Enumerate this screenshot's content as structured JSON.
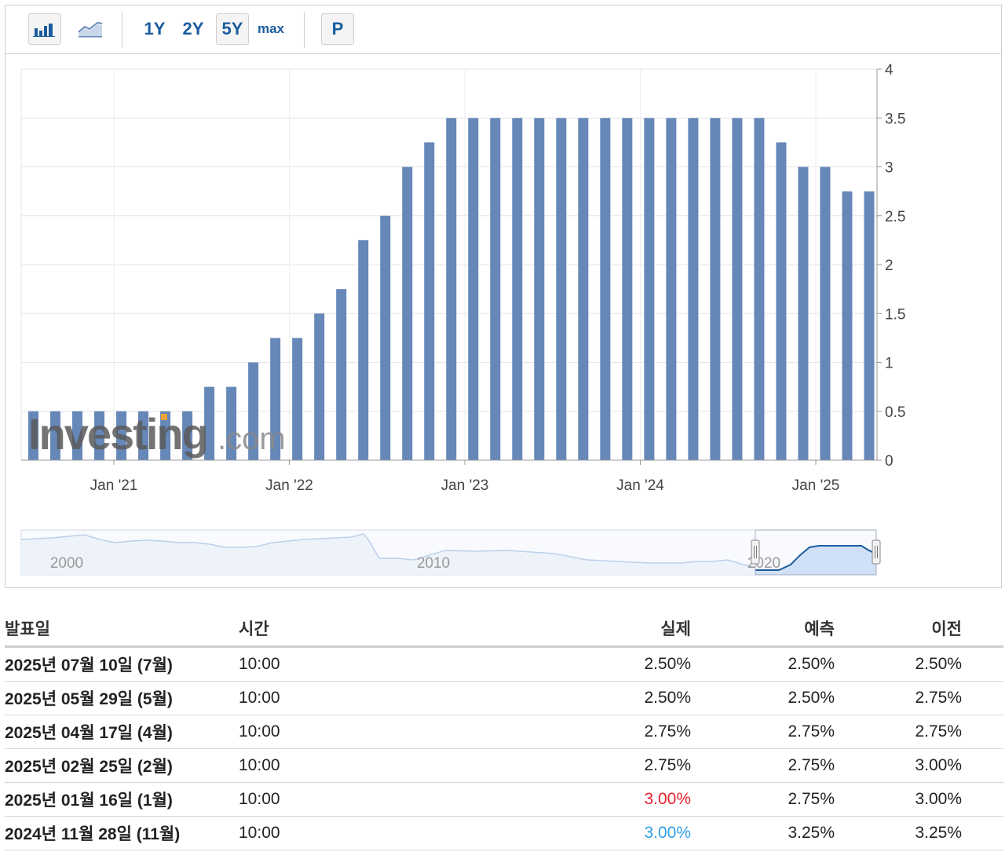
{
  "toolbar": {
    "bar_icon": "bar-chart-icon",
    "line_icon": "line-chart-icon",
    "ranges": [
      "1Y",
      "2Y",
      "5Y",
      "max"
    ],
    "selected_range": "5Y",
    "print_label": "P"
  },
  "watermark": "Investing.com",
  "colors": {
    "bar": "#6688b8",
    "accent": "#1a5c9e",
    "navigator_fill": "#cfe0f7",
    "negative": "#e8222c",
    "positive": "#2f9fe6"
  },
  "chart_data": {
    "type": "bar",
    "y_ticks": [
      "0",
      "0.5",
      "1",
      "1.5",
      "2",
      "2.5",
      "3",
      "3.5",
      "4"
    ],
    "ylim": [
      0,
      4
    ],
    "y_axis_side": "right",
    "x_ticks": [
      "Jan '21",
      "Jan '22",
      "Jan '23",
      "Jan '24",
      "Jan '25"
    ],
    "grid": true,
    "values": [
      0.5,
      0.5,
      0.5,
      0.5,
      0.5,
      0.5,
      0.5,
      0.5,
      0.75,
      0.75,
      1.0,
      1.25,
      1.25,
      1.5,
      1.75,
      2.25,
      2.5,
      3.0,
      3.25,
      3.5,
      3.5,
      3.5,
      3.5,
      3.5,
      3.5,
      3.5,
      3.5,
      3.5,
      3.5,
      3.5,
      3.5,
      3.5,
      3.5,
      3.5,
      3.25,
      3.0,
      3.0,
      2.75,
      2.75
    ],
    "navigator": {
      "labels": [
        "2000",
        "2010",
        "2020"
      ]
    }
  },
  "table": {
    "headers": {
      "date": "발표일",
      "time": "시간",
      "actual": "실제",
      "forecast": "예측",
      "previous": "이전"
    },
    "rows": [
      {
        "date": "2025년 07월 10일 (7월)",
        "time": "10:00",
        "actual": "2.50%",
        "forecast": "2.50%",
        "previous": "2.50%",
        "actual_color": "normal"
      },
      {
        "date": "2025년 05월 29일 (5월)",
        "time": "10:00",
        "actual": "2.50%",
        "forecast": "2.50%",
        "previous": "2.75%",
        "actual_color": "normal"
      },
      {
        "date": "2025년 04월 17일 (4월)",
        "time": "10:00",
        "actual": "2.75%",
        "forecast": "2.75%",
        "previous": "2.75%",
        "actual_color": "normal"
      },
      {
        "date": "2025년 02월 25일 (2월)",
        "time": "10:00",
        "actual": "2.75%",
        "forecast": "2.75%",
        "previous": "3.00%",
        "actual_color": "normal"
      },
      {
        "date": "2025년 01월 16일 (1월)",
        "time": "10:00",
        "actual": "3.00%",
        "forecast": "2.75%",
        "previous": "3.00%",
        "actual_color": "negative"
      },
      {
        "date": "2024년 11월 28일 (11월)",
        "time": "10:00",
        "actual": "3.00%",
        "forecast": "3.25%",
        "previous": "3.25%",
        "actual_color": "positive"
      }
    ]
  }
}
